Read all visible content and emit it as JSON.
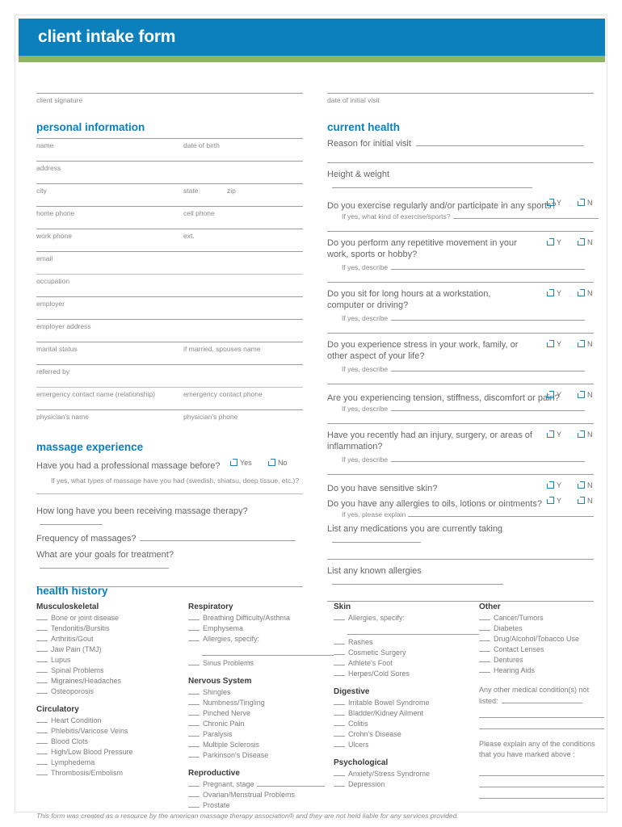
{
  "header": {
    "title": "client intake form",
    "blue": "#0b80bd",
    "green": "#8fb563"
  },
  "top_fields": {
    "client_signature": "client signature",
    "date_of_initial_visit": "date of initial visit"
  },
  "personal_information": {
    "heading": "personal information",
    "rows": [
      {
        "left": "name",
        "right": "date of birth"
      },
      {
        "left": "address",
        "right": ""
      },
      {
        "left": "city",
        "mid": "state",
        "right": "zip"
      },
      {
        "left": "home phone",
        "right": "cell phone"
      },
      {
        "left": "work phone",
        "right": "ext."
      },
      {
        "left": "email",
        "right": ""
      },
      {
        "left": "occupation",
        "right": ""
      },
      {
        "left": "employer",
        "right": ""
      },
      {
        "left": "employer address",
        "right": ""
      },
      {
        "left": "marital status",
        "right": "if married, spouses name"
      },
      {
        "left": "referred by",
        "right": ""
      },
      {
        "left": "emergency contact name (relationship)",
        "right": "emergency contact phone"
      },
      {
        "left": "physician's name",
        "right": "physician's phone"
      }
    ]
  },
  "massage_experience": {
    "heading": "massage experience",
    "q1": "Have you had a professional massage before?",
    "yes": "Yes",
    "no": "No",
    "q1_sub": "If yes, what types of massage have you had (swedish, shiatsu, deep tissue, etc.)?",
    "q2": "How long have you been receiving massage therapy?",
    "q3": "Frequency of massages?",
    "q4": "What are your goals for treatment?"
  },
  "current_health": {
    "heading": "current health",
    "reason": "Reason for initial visit",
    "height_weight": "Height & weight",
    "y": "Y",
    "n": "N",
    "questions": [
      {
        "text": "Do you exercise regularly and/or participate in any sports?",
        "sub": "If yes, what kind of exercise/sports?"
      },
      {
        "text": "Do you perform any repetitive movement in your work, sports or hobby?",
        "sub": "If yes, describe"
      },
      {
        "text": "Do you sit for long hours at a workstation, computer or driving?",
        "sub": "If yes, describe"
      },
      {
        "text": "Do you experience stress in your work, family, or other aspect of your life?",
        "sub": "If yes, describe"
      },
      {
        "text": "Are you experiencing tension, stiffness, discomfort or pain?",
        "sub": "If yes, describe"
      },
      {
        "text": "Have you recently had an injury, surgery, or areas of inflammation?",
        "sub": "If yes, describe"
      },
      {
        "text": "Do you have sensitive skin?",
        "sub": ""
      },
      {
        "text": "Do you have any allergies to oils, lotions or ointments?",
        "sub": "If yes, please explain"
      }
    ],
    "medications": "List any medications you are currently taking",
    "allergies": "List any known allergies"
  },
  "health_history": {
    "heading": "health history",
    "groups": [
      {
        "title": "Musculoskeletal",
        "column": 1,
        "items": [
          "Bone or joint disease",
          "Tendonitis/Bursitis",
          "Arthritis/Gout",
          "Jaw Pain (TMJ)",
          "Lupus",
          "Spinal Problems",
          "Migraines/Headaches",
          "Osteoporosis"
        ]
      },
      {
        "title": "Circulatory",
        "column": 1,
        "items": [
          "Heart Condition",
          "Phlebitis/Varicose Veins",
          "Blood Clots",
          "High/Low Blood Pressure",
          "Lymphedema",
          "Thrombosis/Embolism"
        ]
      },
      {
        "title": "Respiratory",
        "column": 2,
        "items": [
          "Breathing Difficulty/Asthma",
          "Emphysema",
          "Allergies, specify:",
          "Sinus Problems"
        ]
      },
      {
        "title": "Nervous System",
        "column": 2,
        "items": [
          "Shingles",
          "Numbness/Tingling",
          "Pinched Nerve",
          "Chronic Pain",
          "Paralysis",
          "Multiple Sclerosis",
          "Parkinson's Disease"
        ]
      },
      {
        "title": "Reproductive",
        "column": 2,
        "items": [
          "Pregnant, stage",
          "Ovarian/Menstrual Problems",
          "Prostate"
        ]
      },
      {
        "title": "Skin",
        "column": 3,
        "items": [
          "Allergies, specify:",
          "Rashes",
          "Cosmetic Surgery",
          "Athlete's Foot",
          "Herpes/Cold Sores"
        ]
      },
      {
        "title": "Digestive",
        "column": 3,
        "items": [
          "Irritable Bowel Syndrome",
          "Bladder/Kidney Ailment",
          "Colitis",
          "Crohn's Disease",
          "Ulcers"
        ]
      },
      {
        "title": "Psychological",
        "column": 3,
        "items": [
          "Anxiety/Stress Syndrome",
          "Depression"
        ]
      },
      {
        "title": "Other",
        "column": 4,
        "items": [
          "Cancer/Tumors",
          "Diabetes",
          "Drug/Alcohol/Tobacco Use",
          "Contact Lenses",
          "Dentures",
          "Hearing Aids"
        ]
      }
    ],
    "other_note_1": "Any other medical condition(s) not listed:",
    "other_note_2": "Please explain any of the conditions that you have marked above :"
  },
  "footer": {
    "disclaimer": "This form was created as a resource by the american massage therapy association® and they are not held liable for any services provided."
  }
}
